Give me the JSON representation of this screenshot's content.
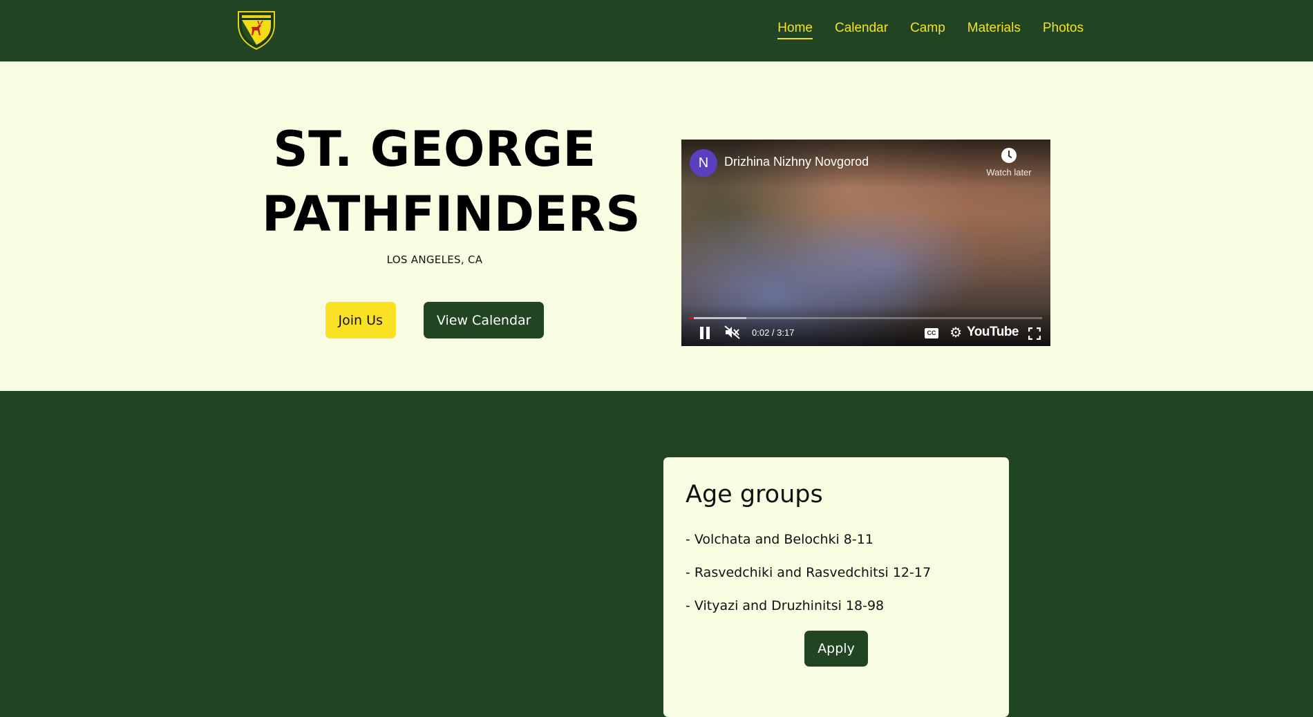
{
  "nav": {
    "logo_alt": "Shield logo",
    "links": [
      {
        "label": "Home",
        "active": true
      },
      {
        "label": "Calendar",
        "active": false
      },
      {
        "label": "Camp",
        "active": false
      },
      {
        "label": "Materials",
        "active": false
      },
      {
        "label": "Photos",
        "active": false
      }
    ]
  },
  "hero": {
    "title_line1": "ST. GEORGE",
    "title_line2": "PATHFINDERS",
    "subtitle": "LOS ANGELES, CA",
    "join_button": "Join Us",
    "calendar_button": "View Calendar"
  },
  "video": {
    "channel_initial": "N",
    "title": "Drizhina Nizhny Novgorod",
    "watch_later": "Watch later",
    "time": "0:02 / 3:17",
    "progress_played": 0.012,
    "progress_buffered": 0.16,
    "cc_label": "CC",
    "brand": "YouTube"
  },
  "age_groups": {
    "title": "Age groups",
    "items": [
      "- Volchata and Belochki 8-11",
      "- Rasvedchiki and Rasvedchitsi 12-17",
      "- Vityazi and Druzhinitsi 18-98"
    ],
    "apply_button": "Apply"
  },
  "colors": {
    "dark_green": "#214523",
    "cream": "#f8fde2",
    "yellow": "#fbe123",
    "nav_text": "#f7e21c"
  }
}
